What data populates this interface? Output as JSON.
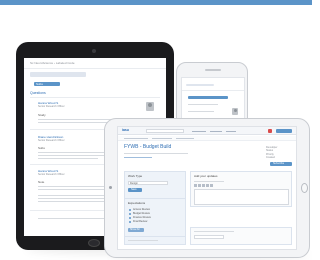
{
  "scene": {
    "accent_color": "#5b94c8",
    "devices": [
      "tablet-portrait",
      "phone",
      "tablet-landscape"
    ]
  },
  "left_tablet": {
    "breadcrumb": "Sc NeuroScience › Labeled Code",
    "tab_label": "Subs",
    "section_title": "Questions",
    "posts": [
      {
        "author": "Hanna Wood S",
        "sub": "Senior Research Officer",
        "label": "Study"
      },
      {
        "author": "Diane Hendrickson",
        "sub": "Senior Research Officer",
        "label": "Subs"
      },
      {
        "author": "Hanna Wood S",
        "sub": "Senior Research Officer",
        "label": "Note"
      }
    ]
  },
  "right_tablet": {
    "logo": "iasu",
    "page_title": "FYWB - Budget Build",
    "meta_labels": [
      "Developer",
      "Status",
      "Priority",
      "Created"
    ],
    "action_label": "Subscribe",
    "left_col": {
      "section1_title": "Work Type",
      "select_value": "Design",
      "button_label": "Save",
      "section2_title": "Expectations",
      "checklist": [
        "Access Review",
        "Budget Review",
        "Finance Review",
        "Final Review"
      ],
      "more_label": "Show All"
    },
    "right_col": {
      "section_title": "Add your updates"
    }
  }
}
